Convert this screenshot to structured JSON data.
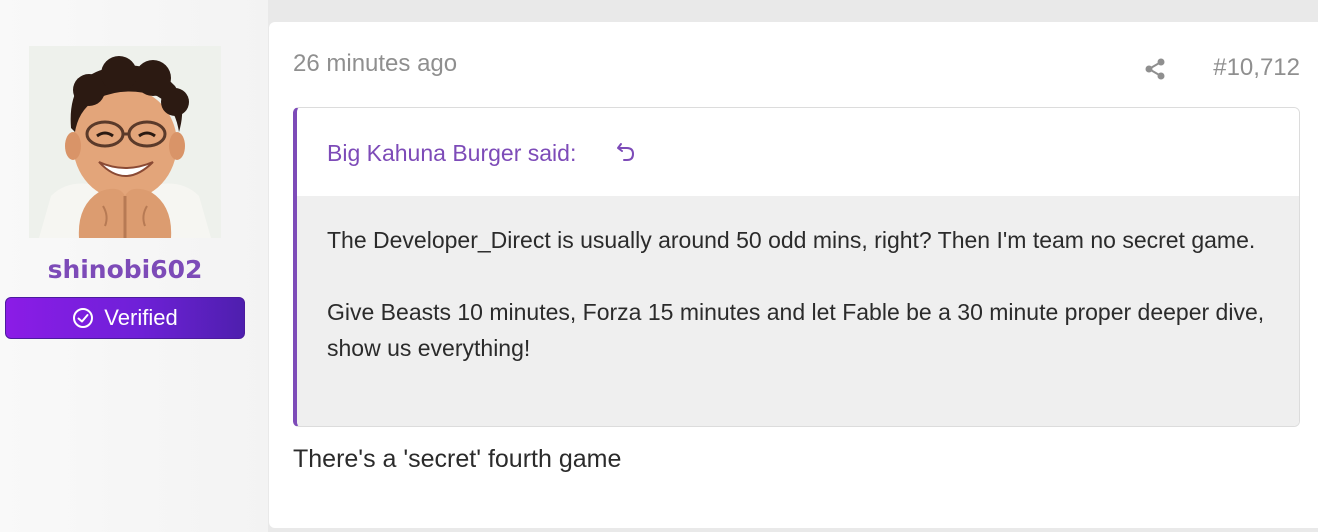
{
  "author": {
    "username": "shinobi602",
    "badge": "Verified",
    "badge_icon": "check-circle-icon",
    "avatar_icon": "user-avatar-photo"
  },
  "post": {
    "timestamp": "26 minutes ago",
    "number": "#10,712",
    "share_icon": "share-icon",
    "quote": {
      "author_line": "Big Kahuna Burger said:",
      "jump_icon": "jump-to-quote-icon",
      "paragraphs": [
        "The Developer_Direct is usually around 50 odd mins, right? Then I'm team no secret game.",
        "Give Beasts 10 minutes, Forza 15 minutes and let Fable be a 30 minute proper deeper dive, show us everything!"
      ]
    },
    "reply_text": "There's a 'secret' fourth game"
  },
  "colors": {
    "accent": "#7d4bb8",
    "badge_gradient_start": "#8b1ce6",
    "badge_gradient_end": "#4e1fae",
    "meta_text": "#8f8f8f",
    "quote_background": "#efefef"
  }
}
